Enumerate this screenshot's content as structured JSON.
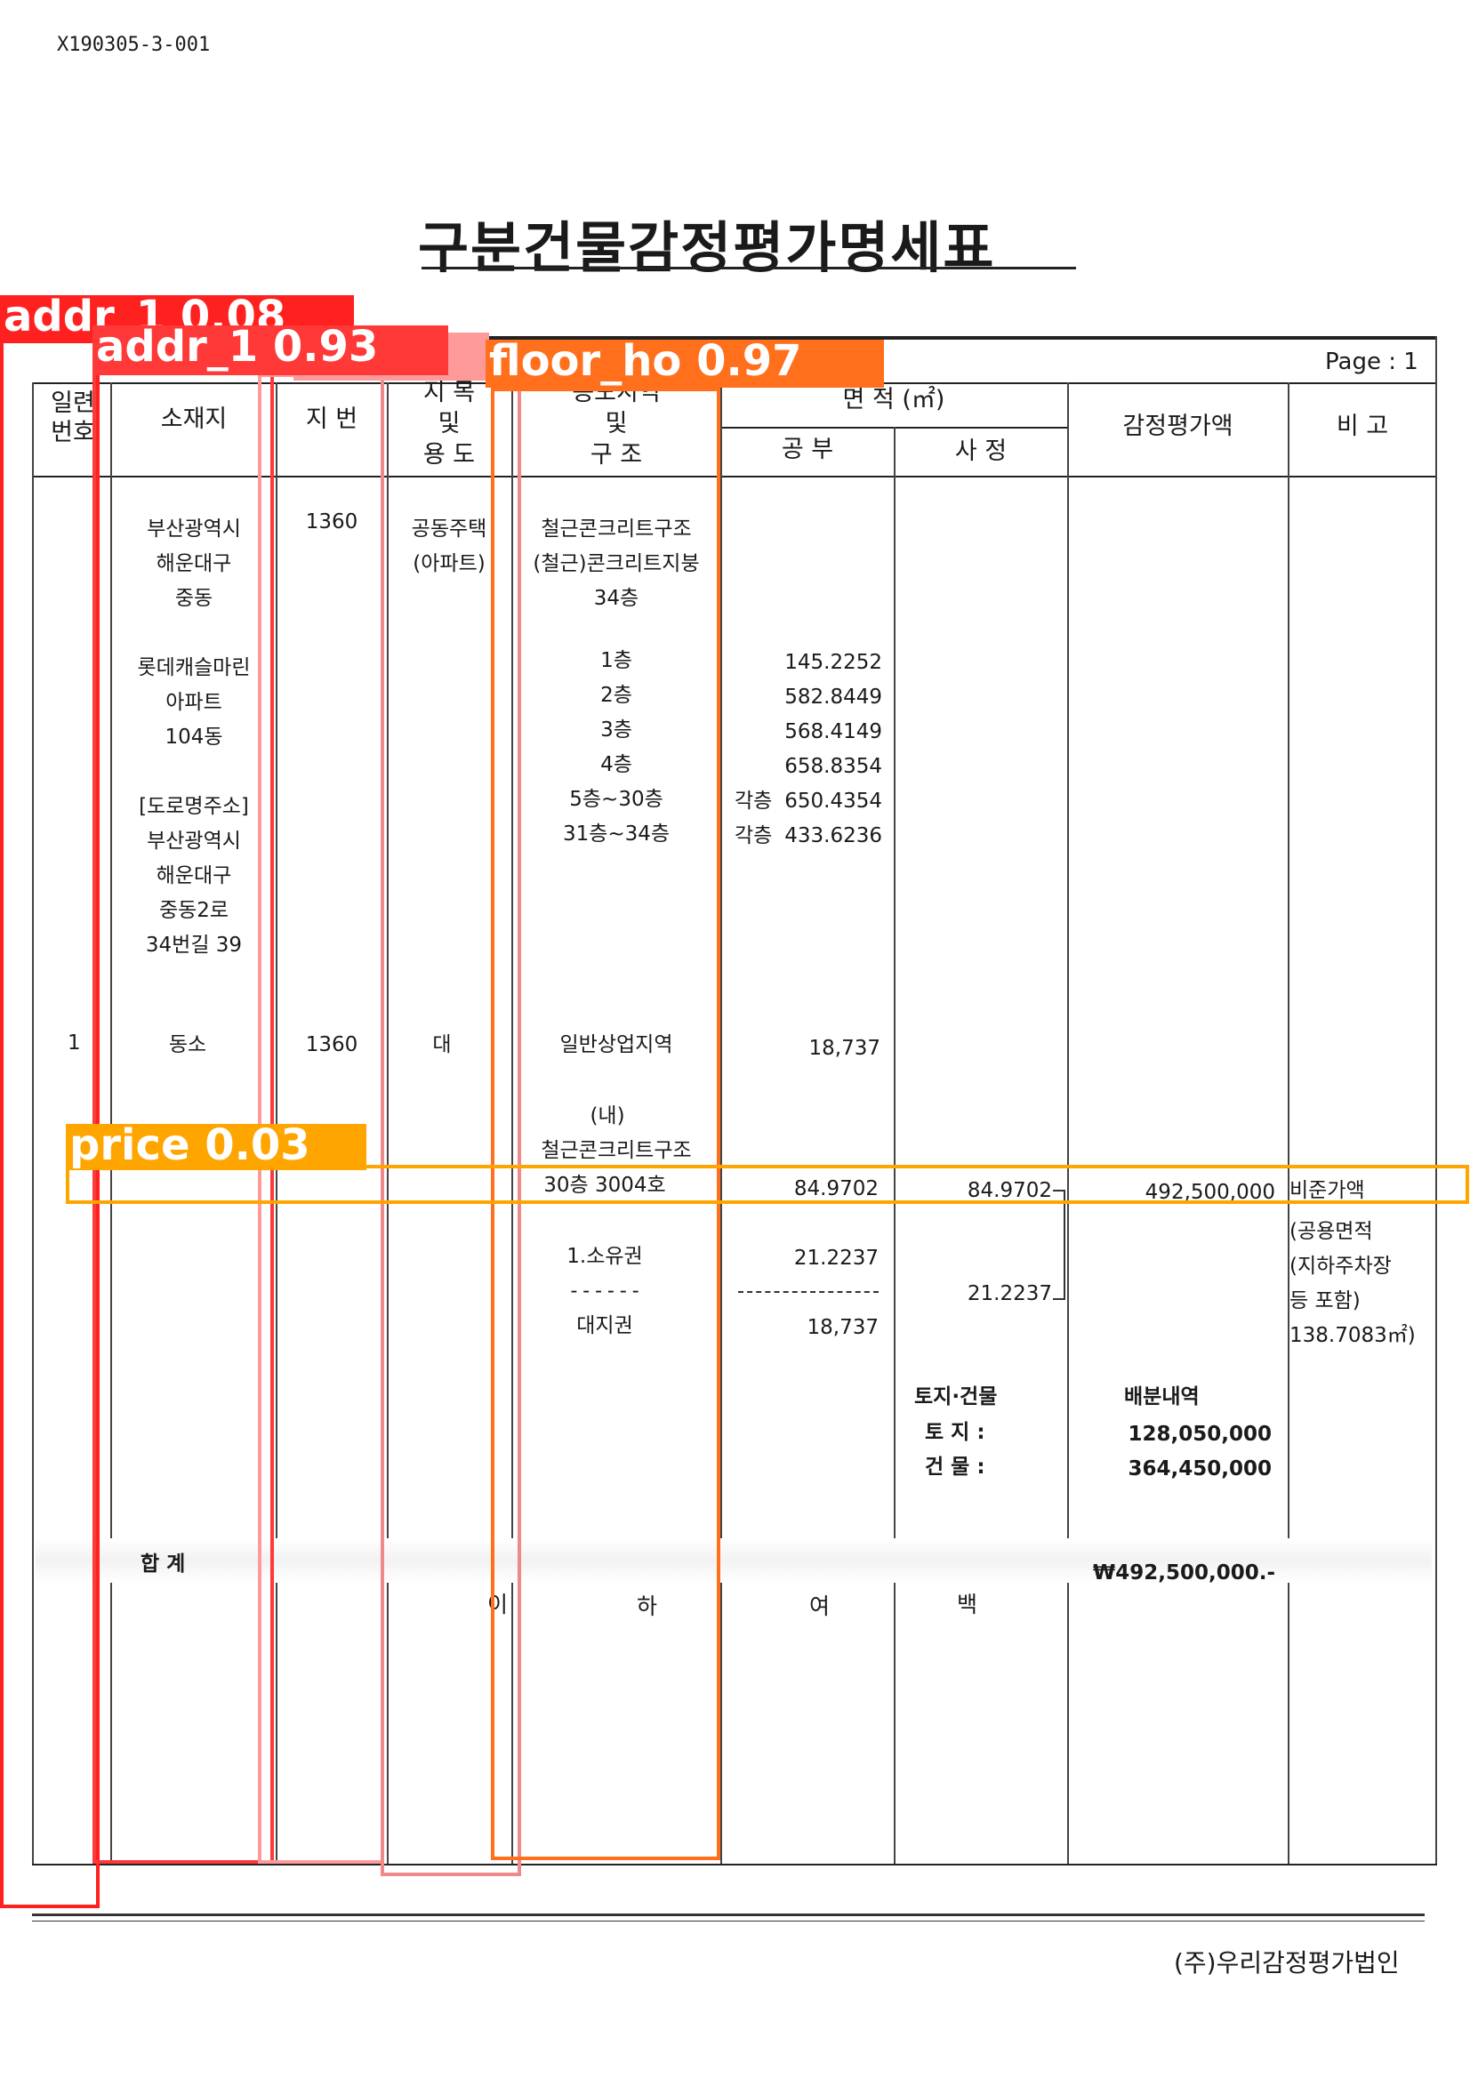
{
  "doc_id": "X190305-3-001",
  "title": "구분건물감정평가명세표",
  "page_label": "Page : 1",
  "headers": {
    "serial": [
      "일련",
      "번호"
    ],
    "location": "소재지",
    "lot": "지 번",
    "category_use": [
      "지 목",
      "및",
      "용 도"
    ],
    "zone_structure": [
      "용도지역",
      "및",
      "구 조"
    ],
    "area": "면 적 (㎡)",
    "area_public": "공 부",
    "area_assessed": "사 정",
    "appraised_value": "감정평가액",
    "remark": "비 고"
  },
  "building": {
    "address": [
      "부산광역시",
      "해운대구",
      "중동"
    ],
    "lot": "1360",
    "use": [
      "공동주택",
      "(아파트)"
    ],
    "structure": [
      "철근콘크리트구조",
      "(철근)콘크리트지붕",
      "34층"
    ],
    "name": [
      "롯데캐슬마린",
      "아파트",
      "104동"
    ],
    "floors": [
      {
        "floor": "1층",
        "prefix": "",
        "area": "145.2252"
      },
      {
        "floor": "2층",
        "prefix": "",
        "area": "582.8449"
      },
      {
        "floor": "3층",
        "prefix": "",
        "area": "568.4149"
      },
      {
        "floor": "4층",
        "prefix": "",
        "area": "658.8354"
      },
      {
        "floor": "5층~30층",
        "prefix": "각층",
        "area": "650.4354"
      },
      {
        "floor": "31층~34층",
        "prefix": "각층",
        "area": "433.6236"
      }
    ],
    "road_address": [
      "[도로명주소]",
      "부산광역시",
      "해운대구",
      "중동2로",
      "34번길 39"
    ]
  },
  "land": {
    "serial": "1",
    "name": "동소",
    "lot": "1360",
    "category": "대",
    "zone": "일반상업지역",
    "area": "18,737"
  },
  "unit": {
    "label": "(내)",
    "structure": "철근콘크리트구조",
    "floor_ho": "30층 3004호",
    "area_public": "84.9702",
    "area_assessed": "84.9702",
    "value": "492,500,000",
    "remark": "비준가액",
    "remark_detail": [
      "(공용면적",
      "(지하주차장",
      "등 포함)",
      "138.7083㎡)"
    ]
  },
  "land_right": {
    "ownership": "1.소유권",
    "dashes": "------",
    "land_right": "대지권",
    "ownership_area": "21.2237",
    "land_area": "18,737",
    "assessed": "21.2237"
  },
  "allocation": {
    "title_left": "토지·건물",
    "title_right": "배분내역",
    "land_label": "토  지 :",
    "land_value": "128,050,000",
    "building_label": "건  물 :",
    "building_value": "364,450,000"
  },
  "total": {
    "label": "합   계",
    "value": "₩492,500,000.-"
  },
  "blank_marks": [
    "이",
    "하",
    "여",
    "백"
  ],
  "company": "(주)우리감정평가법인",
  "detections": [
    {
      "label": "addr_1 0.08",
      "color": "#ff2020"
    },
    {
      "label": "addr_1 0.93",
      "color": "#ff3838"
    },
    {
      "label": "floor_ho 0.97",
      "color": "#ff6f1c"
    },
    {
      "label": "price 0.03",
      "color": "#ffa500"
    }
  ]
}
